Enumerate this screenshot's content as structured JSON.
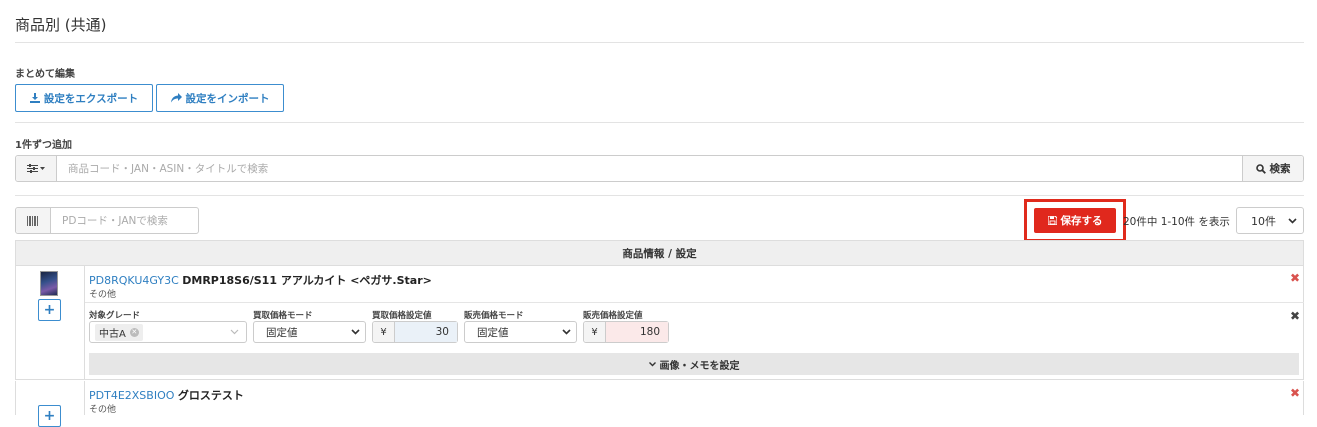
{
  "page": {
    "title": "商品別 (共通)"
  },
  "bulk": {
    "label": "まとめて編集",
    "export_label": "設定をエクスポート",
    "import_label": "設定をインポート"
  },
  "single": {
    "label": "1件ずつ追加",
    "search_placeholder": "商品コード・JAN・ASIN・タイトルで検索",
    "search_button": "検索"
  },
  "toolbar": {
    "pd_placeholder": "PDコード・JANで検索",
    "save_label": "保存する",
    "page_info": "20件中 1-10件 を表示",
    "per_page": "10件"
  },
  "table": {
    "header": "商品情報 / 設定",
    "fields": {
      "grade": "対象グレード",
      "buy_mode": "買取価格モード",
      "buy_price": "買取価格設定値",
      "sell_mode": "販売価格モード",
      "sell_price": "販売価格設定値"
    },
    "expand_label": "画像・メモを設定",
    "currency": "¥",
    "rows": [
      {
        "code": "PD8RQKU4GY3C",
        "name": "DMRP18S6/S11 アアルカイト <ペガサ.Star>",
        "category": "その他",
        "grade": "中古A",
        "buy_mode": "固定値",
        "buy_price": "30",
        "sell_mode": "固定値",
        "sell_price": "180"
      },
      {
        "code": "PDT4E2XSBIOO",
        "name": "グロステスト",
        "category": "その他"
      }
    ]
  },
  "colors": {
    "accent": "#2f7fc1",
    "danger": "#e0281d"
  }
}
